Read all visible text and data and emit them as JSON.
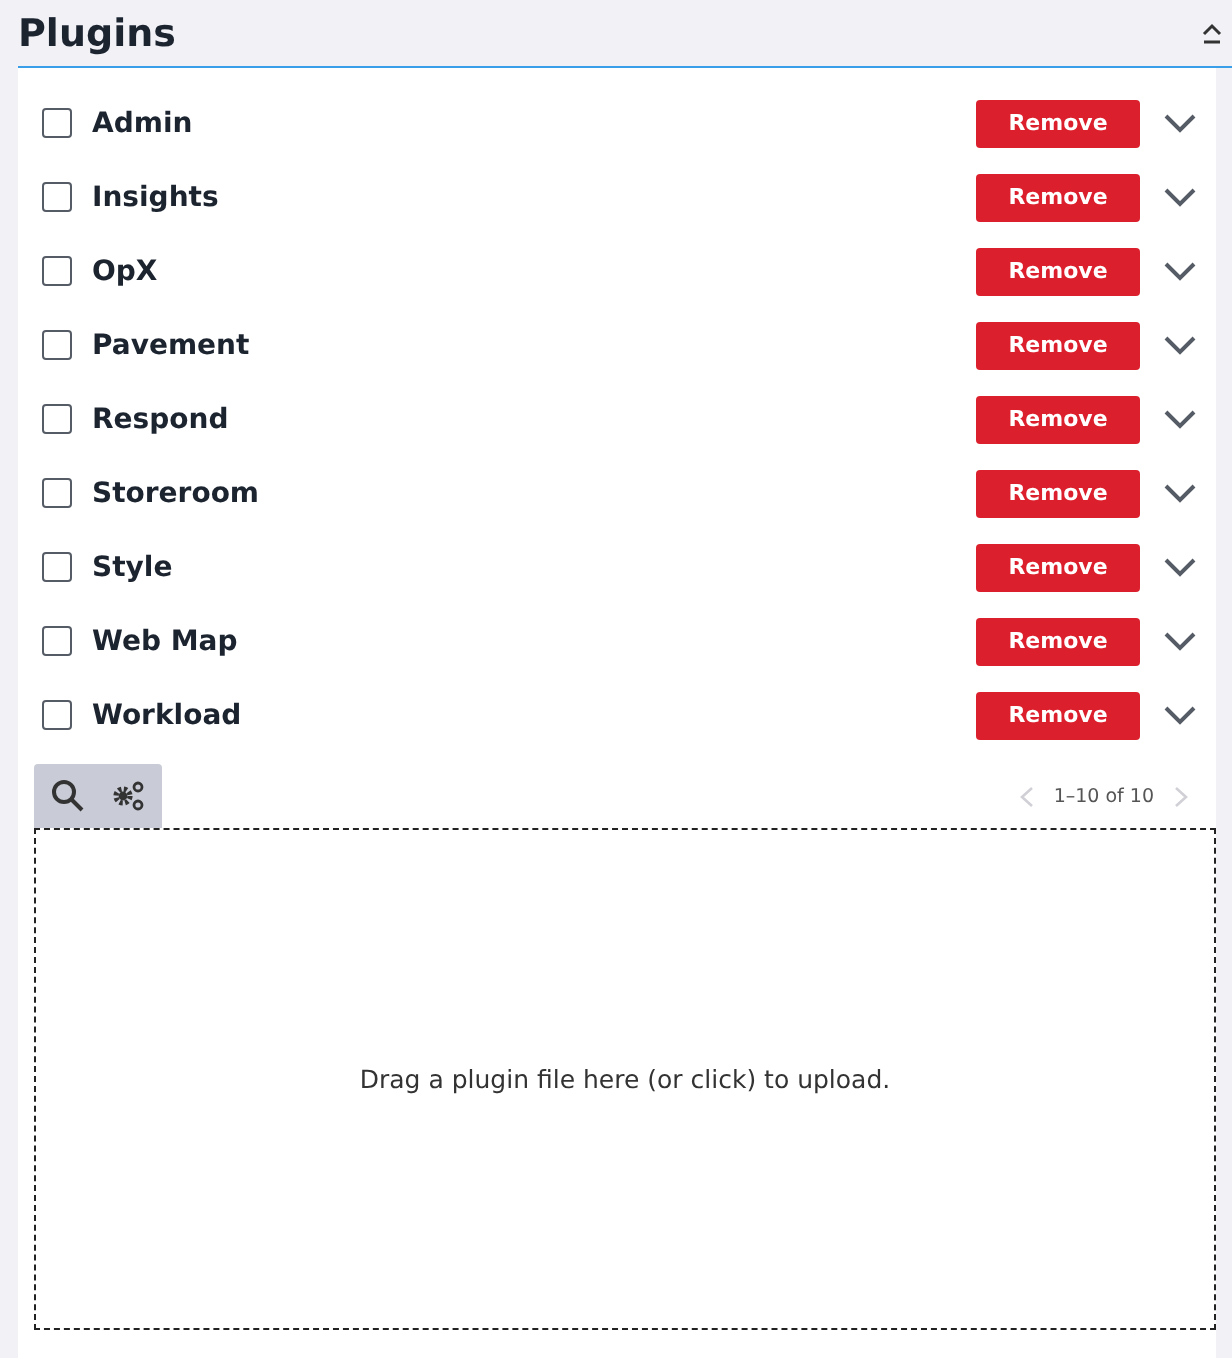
{
  "title": "Plugins",
  "plugins": [
    {
      "name": "Admin",
      "checked": false,
      "expanded": false,
      "action": "Remove"
    },
    {
      "name": "Insights",
      "checked": false,
      "expanded": false,
      "action": "Remove"
    },
    {
      "name": "OpX",
      "checked": false,
      "expanded": false,
      "action": "Remove"
    },
    {
      "name": "Pavement",
      "checked": false,
      "expanded": false,
      "action": "Remove"
    },
    {
      "name": "Respond",
      "checked": false,
      "expanded": false,
      "action": "Remove"
    },
    {
      "name": "Storeroom",
      "checked": false,
      "expanded": false,
      "action": "Remove"
    },
    {
      "name": "Style",
      "checked": false,
      "expanded": false,
      "action": "Remove"
    },
    {
      "name": "Web Map",
      "checked": false,
      "expanded": false,
      "action": "Remove"
    },
    {
      "name": "Workload",
      "checked": false,
      "expanded": false,
      "action": "Remove"
    }
  ],
  "pagination": {
    "range": "1–10 of 10",
    "prev_disabled": true,
    "next_disabled": true
  },
  "dropzone": {
    "text": "Drag a plugin file here (or click) to upload."
  }
}
